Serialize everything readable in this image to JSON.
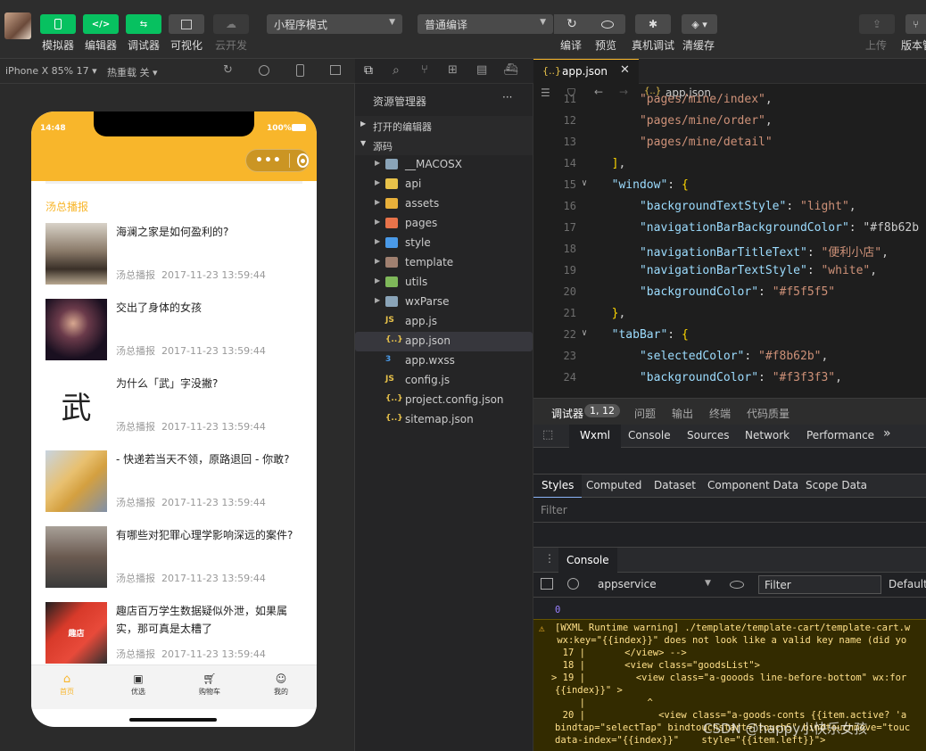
{
  "toolbar": {
    "buttons": [
      {
        "label": "模拟器"
      },
      {
        "label": "编辑器"
      },
      {
        "label": "调试器"
      },
      {
        "label": "可视化"
      },
      {
        "label": "云开发"
      }
    ],
    "mode_select": "小程序模式",
    "compile_select": "普通编译",
    "actions": [
      {
        "label": "编译"
      },
      {
        "label": "预览"
      },
      {
        "label": "真机调试"
      },
      {
        "label": "清缓存"
      }
    ],
    "right": [
      {
        "label": "上传"
      },
      {
        "label": "版本管"
      }
    ]
  },
  "simulator": {
    "device": "iPhone X 85% 17 ▾",
    "hotreload": "热重载 关 ▾",
    "status_time": "14:48",
    "status_battery": "100%",
    "section_title": "汤总播报",
    "news": [
      {
        "title": "海澜之家是如何盈利的?",
        "source": "汤总播报",
        "time": "2017-11-23 13:59:44",
        "thumb": "clothing-store-photo"
      },
      {
        "title": "交出了身体的女孩",
        "source": "汤总播报",
        "time": "2017-11-23 13:59:44",
        "thumb": "singer-photo"
      },
      {
        "title": "为什么「武」字没撇?",
        "source": "汤总播报",
        "time": "2017-11-23 13:59:44",
        "thumb": "calligraphy",
        "thumb_text": "武"
      },
      {
        "title": "- 快递若当天不领，原路退回 - 你敢?",
        "source": "汤总播报",
        "time": "2017-11-23 13:59:44",
        "thumb": "courier-photo"
      },
      {
        "title": "有哪些对犯罪心理学影响深远的案件?",
        "source": "汤总播报",
        "time": "2017-11-23 13:59:44",
        "thumb": "meeting-photo"
      },
      {
        "title": "趣店百万学生数据疑似外泄，如果属实，那可真是太糟了",
        "source": "汤总播报",
        "time": "2017-11-23 13:59:44",
        "thumb": "phone-app-photo",
        "thumb_text": "趣店"
      }
    ],
    "tabs": [
      {
        "label": "首页",
        "icon": "home-icon"
      },
      {
        "label": "优选",
        "icon": "inbox-icon"
      },
      {
        "label": "购物车",
        "icon": "cart-icon"
      },
      {
        "label": "我的",
        "icon": "user-icon"
      }
    ],
    "accent": "#f8b62b"
  },
  "explorer": {
    "title": "资源管理器",
    "more": "···",
    "open_editors": "打开的编辑器",
    "root": "源码",
    "items": [
      {
        "name": "__MACOSX",
        "type": "folder",
        "color": "#8aa4b8"
      },
      {
        "name": "api",
        "type": "folder",
        "color": "#e8c24a"
      },
      {
        "name": "assets",
        "type": "folder",
        "color": "#e8b03a"
      },
      {
        "name": "pages",
        "type": "folder",
        "color": "#e8734a"
      },
      {
        "name": "style",
        "type": "folder",
        "color": "#4a9ae8"
      },
      {
        "name": "template",
        "type": "folder",
        "color": "#a08070"
      },
      {
        "name": "utils",
        "type": "folder",
        "color": "#7fb85a"
      },
      {
        "name": "wxParse",
        "type": "folder",
        "color": "#8aa4b8"
      },
      {
        "name": "app.js",
        "type": "file",
        "badge": "JS",
        "color": "#e8c24a"
      },
      {
        "name": "app.json",
        "type": "file",
        "badge": "{..}",
        "color": "#e8c24a"
      },
      {
        "name": "app.wxss",
        "type": "file",
        "badge": "3",
        "color": "#4a9ae8"
      },
      {
        "name": "config.js",
        "type": "file",
        "badge": "JS",
        "color": "#e8c24a"
      },
      {
        "name": "project.config.json",
        "type": "file",
        "badge": "{..}",
        "color": "#e8c24a"
      },
      {
        "name": "sitemap.json",
        "type": "file",
        "badge": "{..}",
        "color": "#e8c24a"
      }
    ]
  },
  "editor": {
    "tab": "app.json",
    "breadcrumb": "app.json",
    "lines": [
      {
        "n": "11",
        "fold": "",
        "text": "      \"pages/mine/index\","
      },
      {
        "n": "12",
        "fold": "",
        "text": "      \"pages/mine/order\","
      },
      {
        "n": "13",
        "fold": "",
        "text": "      \"pages/mine/detail\""
      },
      {
        "n": "14",
        "fold": "",
        "text": "  ],"
      },
      {
        "n": "15",
        "fold": "∨",
        "text": "  \"window\": {"
      },
      {
        "n": "16",
        "fold": "",
        "text": "      \"backgroundTextStyle\": \"light\","
      },
      {
        "n": "17",
        "fold": "",
        "text": "      \"navigationBarBackgroundColor\": \"#f8b62b"
      },
      {
        "n": "18",
        "fold": "",
        "text": "      \"navigationBarTitleText\": \"便利小店\","
      },
      {
        "n": "19",
        "fold": "",
        "text": "      \"navigationBarTextStyle\": \"white\","
      },
      {
        "n": "20",
        "fold": "",
        "text": "      \"backgroundColor\": \"#f5f5f5\""
      },
      {
        "n": "21",
        "fold": "",
        "text": "  },"
      },
      {
        "n": "22",
        "fold": "∨",
        "text": "  \"tabBar\": {"
      },
      {
        "n": "23",
        "fold": "",
        "text": "      \"selectedColor\": \"#f8b62b\","
      },
      {
        "n": "24",
        "fold": "",
        "text": "      \"backgroundColor\": \"#f3f3f3\","
      }
    ]
  },
  "debug": {
    "tabs": [
      "调试器",
      "问题",
      "输出",
      "终端",
      "代码质量"
    ],
    "badge": "1, 12",
    "devtools_tabs": [
      "Wxml",
      "Console",
      "Sources",
      "Network",
      "Performance"
    ],
    "styles_tabs": [
      "Styles",
      "Computed",
      "Dataset",
      "Component Data",
      "Scope Data"
    ],
    "filter_placeholder": "Filter",
    "console_tab": "Console",
    "context": "appservice",
    "console_filter": "Filter",
    "level": "Default",
    "zero": "0",
    "warning_lines": [
      "[WXML Runtime warning] ./template/template-cart/template-cart.w",
      " wx:key=\"{{index}}\" does not look like a valid key name (did yo",
      "  17 |       </view> -->",
      "  18 |       <view class=\"goodsList\">",
      "> 19 |         <view class=\"a-gooods line-before-bottom\" wx:for",
      "{{index}}\" >",
      "     |           ^",
      "  20 |             <view class=\"a-goods-conts {{item.active? 'a",
      "bindtap=\"selectTap\" bindtouchstart=\"touchS\" bindtouchmove=\"touc",
      "data-index=\"{{index}}\"    style=\"{{item.left}}\">"
    ],
    "watermark": "CSDN @happy小快乐女孩"
  }
}
